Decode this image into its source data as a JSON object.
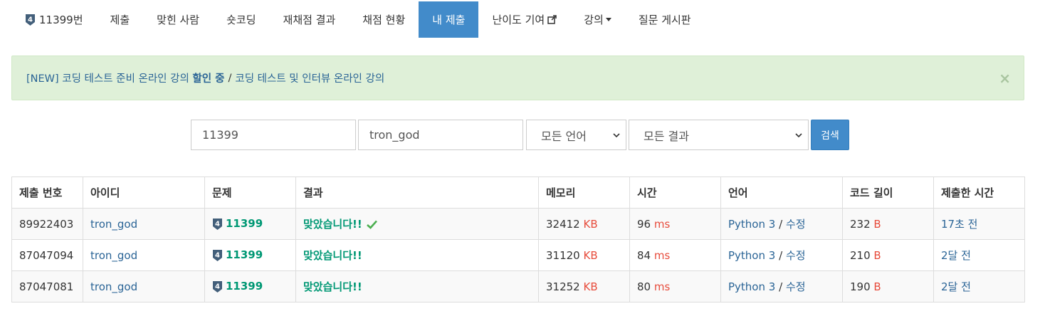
{
  "nav": {
    "problem_tier": "4",
    "problem_label": "11399번",
    "items": [
      {
        "label": "제출"
      },
      {
        "label": "맞힌 사람"
      },
      {
        "label": "숏코딩"
      },
      {
        "label": "재채점 결과"
      },
      {
        "label": "채점 현황"
      },
      {
        "label": "내 제출",
        "active": true
      },
      {
        "label": "난이도 기여"
      },
      {
        "label": "강의"
      },
      {
        "label": "질문 게시판"
      }
    ]
  },
  "alert": {
    "prefix": "[NEW] 코딩 테스트 준비 온라인 강의",
    "bold": "할인 중",
    "separator": "/",
    "link2": "코딩 테스트 및 인터뷰 온라인 강의",
    "close": "×"
  },
  "search": {
    "problem_id": "11399",
    "user_id": "tron_god",
    "language": "모든 언어",
    "result": "모든 결과",
    "button": "검색"
  },
  "table": {
    "headers": [
      "제출 번호",
      "아이디",
      "문제",
      "결과",
      "메모리",
      "시간",
      "언어",
      "코드 길이",
      "제출한 시간"
    ],
    "rows": [
      {
        "id": "89922403",
        "user": "tron_god",
        "tier": "4",
        "problem": "11399",
        "result": "맞았습니다!!",
        "checked": true,
        "memory": "32412",
        "memory_unit": "KB",
        "time": "96",
        "time_unit": "ms",
        "language": "Python 3",
        "lang_sep": "/",
        "edit": "수정",
        "length": "232",
        "length_unit": "B",
        "submitted": "17초 전"
      },
      {
        "id": "87047094",
        "user": "tron_god",
        "tier": "4",
        "problem": "11399",
        "result": "맞았습니다!!",
        "checked": false,
        "memory": "31120",
        "memory_unit": "KB",
        "time": "84",
        "time_unit": "ms",
        "language": "Python 3",
        "lang_sep": "/",
        "edit": "수정",
        "length": "210",
        "length_unit": "B",
        "submitted": "2달 전"
      },
      {
        "id": "87047081",
        "user": "tron_god",
        "tier": "4",
        "problem": "11399",
        "result": "맞았습니다!!",
        "checked": false,
        "memory": "31252",
        "memory_unit": "KB",
        "time": "80",
        "time_unit": "ms",
        "language": "Python 3",
        "lang_sep": "/",
        "edit": "수정",
        "length": "190",
        "length_unit": "B",
        "submitted": "2달 전"
      }
    ]
  },
  "colors": {
    "primary": "#428bca",
    "link": "#2a6496",
    "accepted": "#009874",
    "unit": "#e74c3c",
    "alert_bg": "#dff0d8"
  }
}
